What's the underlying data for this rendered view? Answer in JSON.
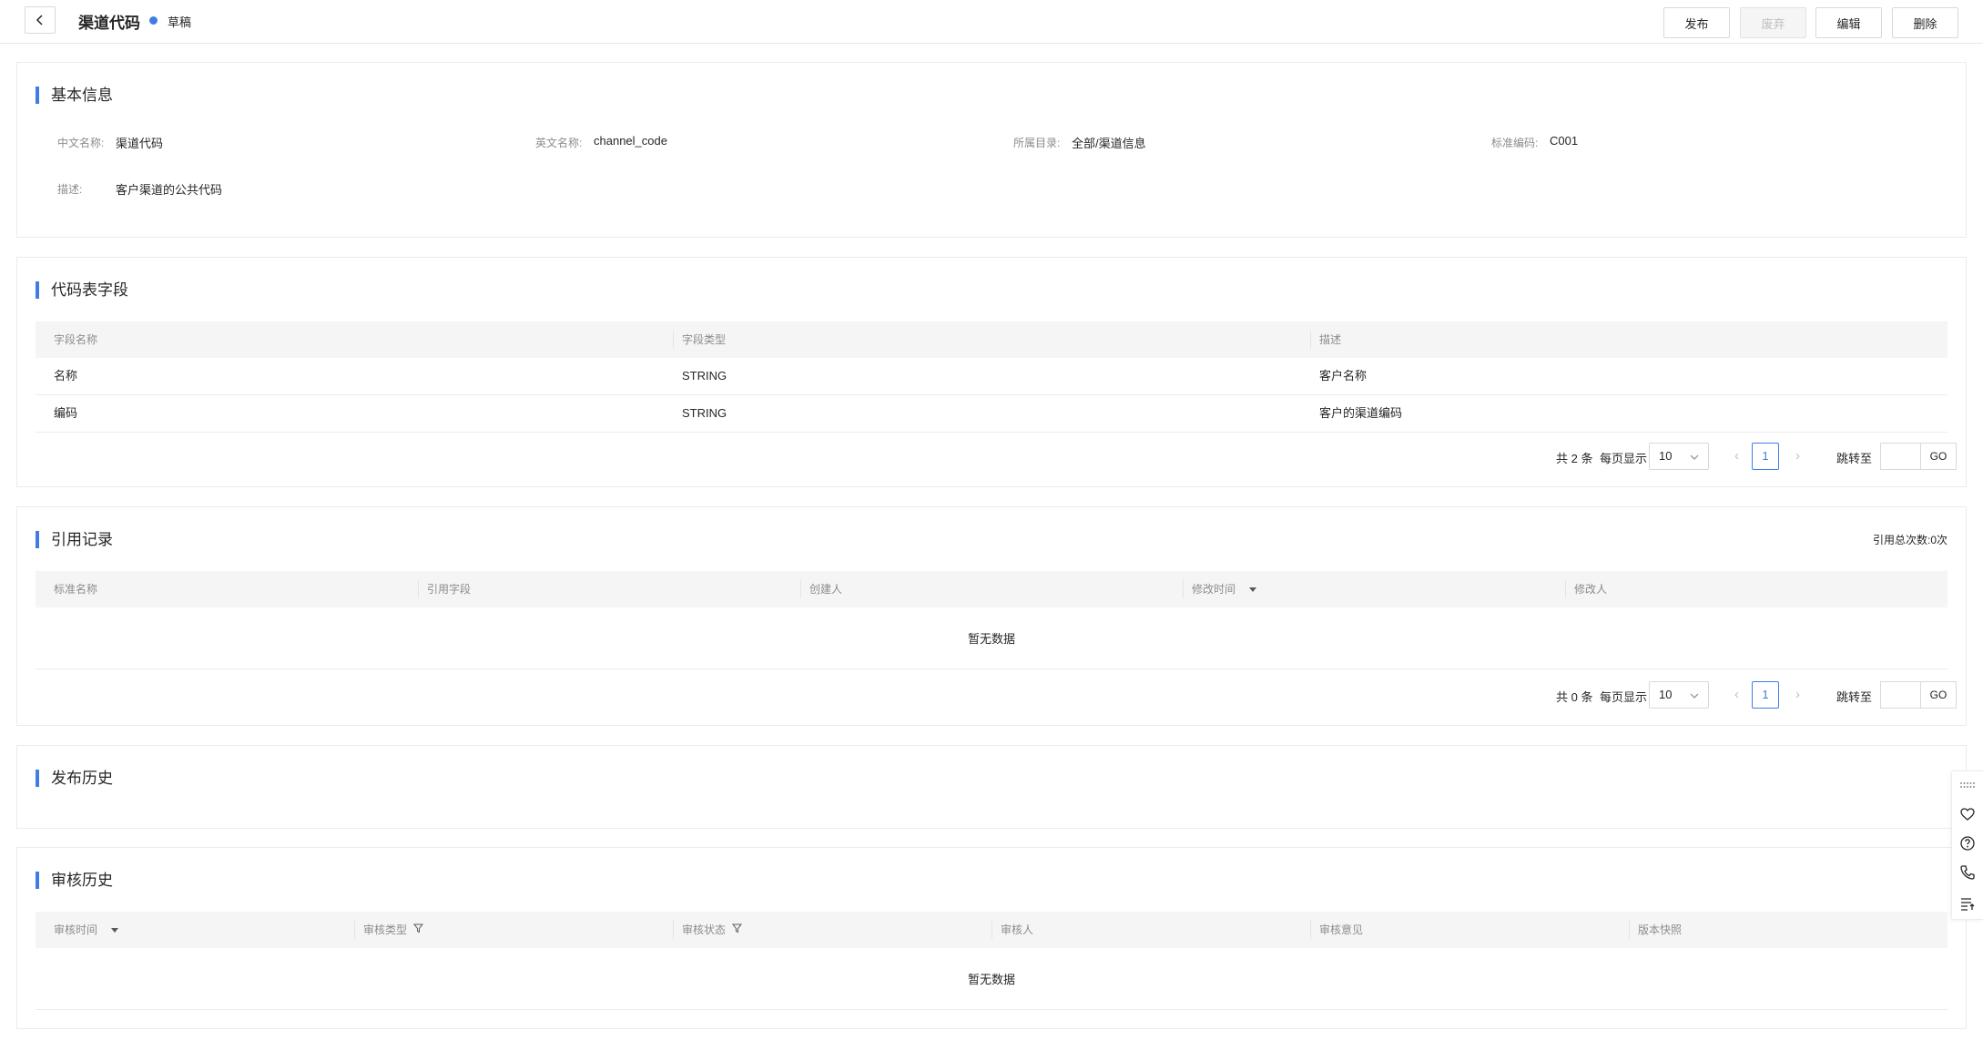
{
  "header": {
    "title": "渠道代码",
    "status": "草稿",
    "status_color": "#3f7ce6",
    "buttons": {
      "publish": "发布",
      "deprecate": "废弃",
      "edit": "编辑",
      "delete": "删除"
    }
  },
  "basic_info": {
    "title": "基本信息",
    "fields": [
      {
        "label": "中文名称:",
        "value": "渠道代码"
      },
      {
        "label": "英文名称:",
        "value": "channel_code"
      },
      {
        "label": "所属目录:",
        "value": "全部/渠道信息"
      },
      {
        "label": "标准编码:",
        "value": "C001"
      },
      {
        "label": "描述:",
        "value": "客户渠道的公共代码"
      }
    ]
  },
  "code_fields": {
    "title": "代码表字段",
    "columns": [
      "字段名称",
      "字段类型",
      "描述"
    ],
    "rows": [
      [
        "名称",
        "STRING",
        "客户名称"
      ],
      [
        "编码",
        "STRING",
        "客户的渠道编码"
      ]
    ],
    "pagination": {
      "total": "共 2 条",
      "page_size_label": "每页显示",
      "page_size": "10",
      "page": "1",
      "jump_label": "跳转至",
      "go": "GO"
    }
  },
  "references": {
    "title": "引用记录",
    "total_label": "引用总次数:0次",
    "columns": [
      "标准名称",
      "引用字段",
      "创建人",
      "修改时间",
      "修改人"
    ],
    "empty": "暂无数据",
    "pagination": {
      "total": "共 0 条",
      "page_size_label": "每页显示",
      "page_size": "10",
      "page": "1",
      "jump_label": "跳转至",
      "go": "GO"
    }
  },
  "publish_history": {
    "title": "发布历史"
  },
  "review_history": {
    "title": "审核历史",
    "columns": [
      "审核时间",
      "审核类型",
      "审核状态",
      "审核人",
      "审核意见",
      "版本快照"
    ],
    "empty": "暂无数据"
  },
  "icons": {
    "back": "chevron-left-icon",
    "sort": "caret-down-icon",
    "filter": "filter-icon",
    "float_bar": [
      "drag-dots-icon",
      "heart-chat-icon",
      "help-circle-icon",
      "phone-icon",
      "list-icon"
    ]
  }
}
